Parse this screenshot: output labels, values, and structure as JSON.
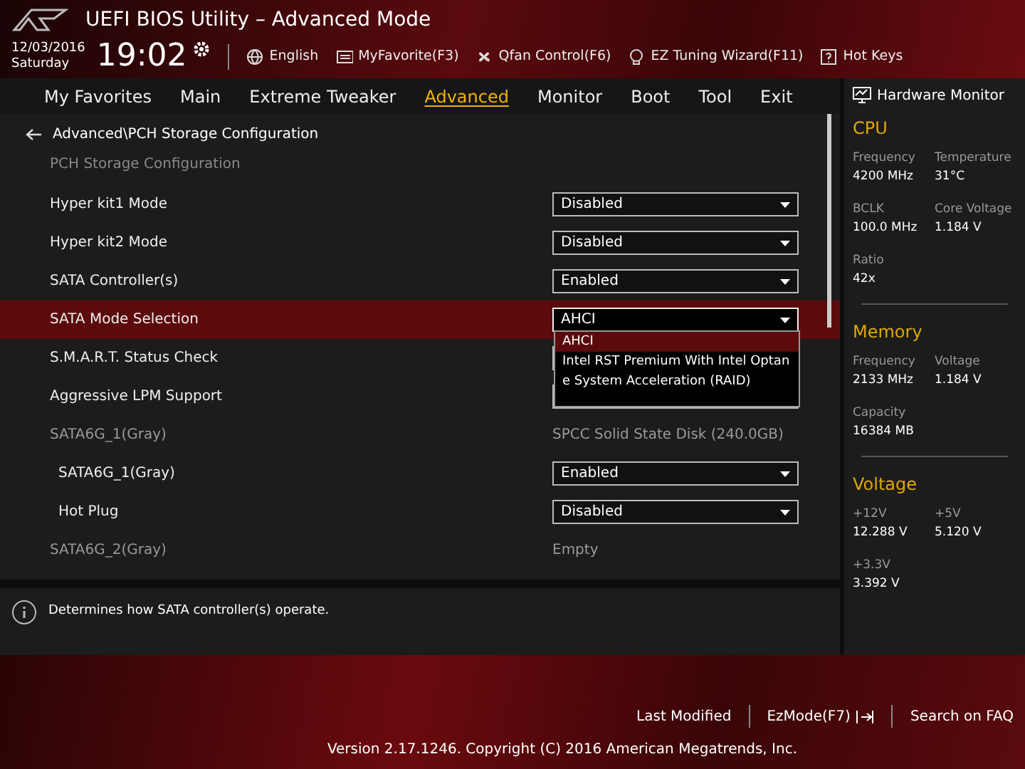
{
  "header": {
    "title": "UEFI BIOS Utility – Advanced Mode",
    "date": "12/03/2016",
    "day": "Saturday",
    "time": "19:02",
    "tools": [
      {
        "kind": "globe",
        "label": "English"
      },
      {
        "kind": "favorite",
        "label": "MyFavorite(F3)"
      },
      {
        "kind": "fan",
        "label": "Qfan Control(F6)"
      },
      {
        "kind": "bulb",
        "label": "EZ Tuning Wizard(F11)"
      },
      {
        "kind": "help",
        "label": "Hot Keys"
      }
    ]
  },
  "tabs": [
    {
      "label": "My Favorites",
      "selected": false
    },
    {
      "label": "Main",
      "selected": false
    },
    {
      "label": "Extreme Tweaker",
      "selected": false
    },
    {
      "label": "Advanced",
      "selected": true
    },
    {
      "label": "Monitor",
      "selected": false
    },
    {
      "label": "Boot",
      "selected": false
    },
    {
      "label": "Tool",
      "selected": false
    },
    {
      "label": "Exit",
      "selected": false
    }
  ],
  "breadcrumb": "Advanced\\PCH Storage Configuration",
  "subtitle": "PCH Storage Configuration",
  "rows": [
    {
      "kind": "select",
      "label": "Hyper kit1 Mode",
      "value": "Disabled",
      "selected": false
    },
    {
      "kind": "select",
      "label": "Hyper kit2 Mode",
      "value": "Disabled",
      "selected": false
    },
    {
      "kind": "select",
      "label": "SATA Controller(s)",
      "value": "Enabled",
      "selected": false
    },
    {
      "kind": "select",
      "label": "SATA Mode Selection",
      "value": "AHCI",
      "selected": true,
      "options": [
        {
          "label": "AHCI",
          "selected": true
        },
        {
          "label": "Intel RST Premium With Intel Optane System Acceleration (RAID)",
          "selected": false
        }
      ]
    },
    {
      "kind": "select",
      "label": "S.M.A.R.T. Status Check",
      "selected": false
    },
    {
      "kind": "select",
      "label": "Aggressive LPM Support",
      "selected": false
    },
    {
      "kind": "section",
      "label": "SATA6G_1(Gray)",
      "value": "SPCC Solid State Disk (240.0GB)",
      "selected": false,
      "children": [
        {
          "kind": "select",
          "label": "SATA6G_1(Gray)",
          "value": "Enabled",
          "selected": false
        },
        {
          "kind": "select",
          "label": "Hot Plug",
          "value": "Disabled",
          "selected": false
        }
      ]
    },
    {
      "kind": "section",
      "label": "SATA6G_2(Gray)",
      "value": "Empty",
      "selected": false
    }
  ],
  "help": "Determines how SATA controller(s) operate.",
  "monitor": {
    "title": "Hardware Monitor",
    "sections": [
      {
        "title": "CPU",
        "items": [
          {
            "label": "Frequency",
            "value": "4200 MHz"
          },
          {
            "label": "Temperature",
            "value": "31°C"
          },
          {
            "label": "BCLK",
            "value": "100.0 MHz"
          },
          {
            "label": "Core Voltage",
            "value": "1.184 V"
          },
          {
            "label": "Ratio",
            "value": "42x"
          }
        ]
      },
      {
        "title": "Memory",
        "items": [
          {
            "label": "Frequency",
            "value": "2133 MHz"
          },
          {
            "label": "Voltage",
            "value": "1.184 V"
          },
          {
            "label": "Capacity",
            "value": "16384 MB"
          }
        ]
      },
      {
        "title": "Voltage",
        "items": [
          {
            "label": "+12V",
            "value": "12.288 V"
          },
          {
            "label": "+5V",
            "value": "5.120 V"
          },
          {
            "label": "+3.3V",
            "value": "3.392 V"
          }
        ]
      }
    ]
  },
  "footer": {
    "links": [
      {
        "kind": "plain",
        "label": "Last Modified"
      },
      {
        "kind": "exit",
        "label": "EzMode(F7)"
      },
      {
        "kind": "plain",
        "label": "Search on FAQ"
      }
    ],
    "version": "Version 2.17.1246. Copyright (C) 2016 American Megatrends, Inc."
  }
}
